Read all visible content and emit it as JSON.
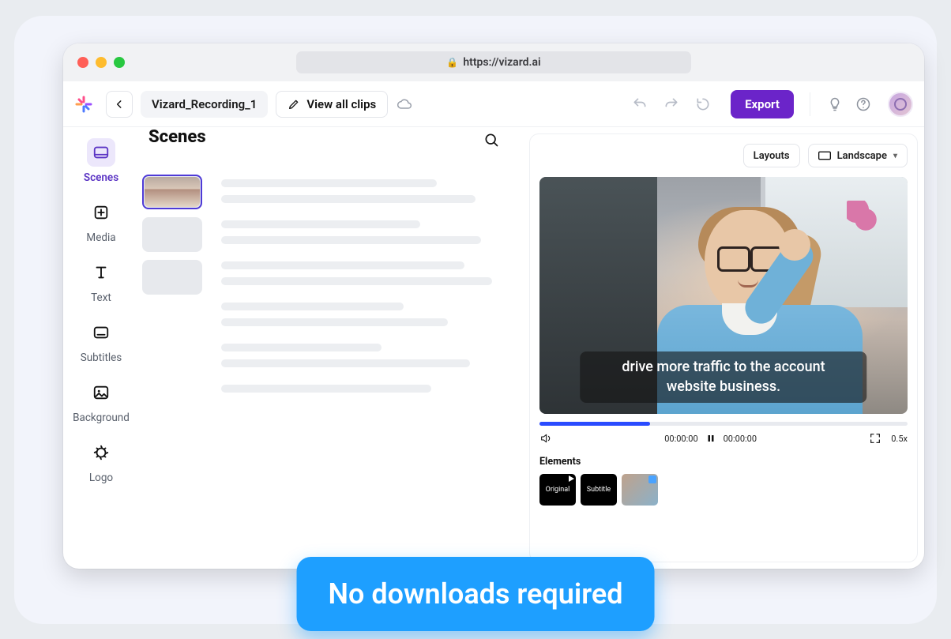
{
  "browser": {
    "url": "https://vizard.ai"
  },
  "toolbar": {
    "project_name": "Vizard_Recording_1",
    "view_all_clips": "View all clips",
    "export": "Export"
  },
  "rail": {
    "items": [
      {
        "label": "Scenes"
      },
      {
        "label": "Media"
      },
      {
        "label": "Text"
      },
      {
        "label": "Subtitles"
      },
      {
        "label": "Background"
      },
      {
        "label": "Logo"
      }
    ]
  },
  "center": {
    "title": "Scenes"
  },
  "preview": {
    "layouts_label": "Layouts",
    "orientation_label": "Landscape",
    "caption_line1": "drive more traffic to the account",
    "caption_line2": "website business.",
    "time_left": "00:00:00",
    "time_right": "00:00:00",
    "speed": "0.5x",
    "elements_label": "Elements",
    "elements": [
      {
        "label": "Original"
      },
      {
        "label": "Subtitle"
      },
      {
        "label": ""
      }
    ]
  },
  "banner": {
    "text": "No downloads required"
  }
}
